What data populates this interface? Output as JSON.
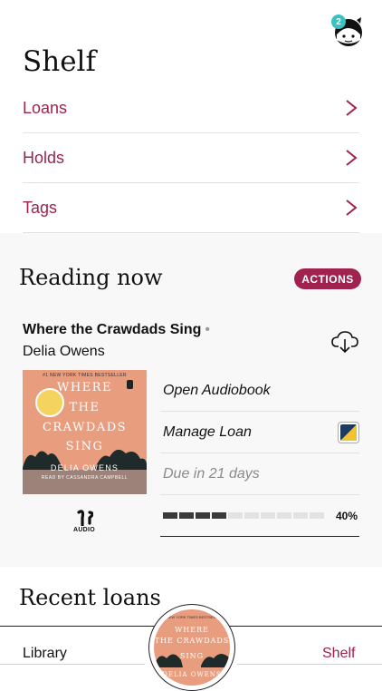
{
  "header": {
    "notification_count": "2"
  },
  "page": {
    "title": "Shelf"
  },
  "nav": [
    {
      "label": "Loans"
    },
    {
      "label": "Holds"
    },
    {
      "label": "Tags"
    }
  ],
  "reading_now": {
    "heading": "Reading now",
    "actions_label": "ACTIONS",
    "book": {
      "title": "Where the Crawdads Sing",
      "separator": "•",
      "author": "Delia Owens",
      "format_label": "AUDIO",
      "cover": {
        "bestseller": "#1 NEW YORK TIMES BESTSELLER",
        "line1": "WHERE",
        "line2": "THE",
        "line3": "CRAWDADS",
        "line4": "SING",
        "author": "DELIA OWENS",
        "reader": "READ BY CASSANDRA CAMPBELL"
      }
    },
    "options": {
      "open": "Open Audiobook",
      "manage": "Manage Loan",
      "due": "Due in 21 days"
    },
    "progress": {
      "percent_label": "40%",
      "fraction": 0.4,
      "segments": 10
    }
  },
  "recent": {
    "heading": "Recent loans"
  },
  "tabbar": {
    "left_label": "Library",
    "right_label": "Shelf",
    "center_cover": {
      "bestseller": "#1 NEW YORK TIMES BESTSELLER",
      "line1": "WHERE",
      "line2": "THE CRAWDADS",
      "line3": "SING",
      "author": "DELIA OWENS"
    }
  },
  "colors": {
    "accent": "#a0224f",
    "badge": "#3cc0c0"
  }
}
